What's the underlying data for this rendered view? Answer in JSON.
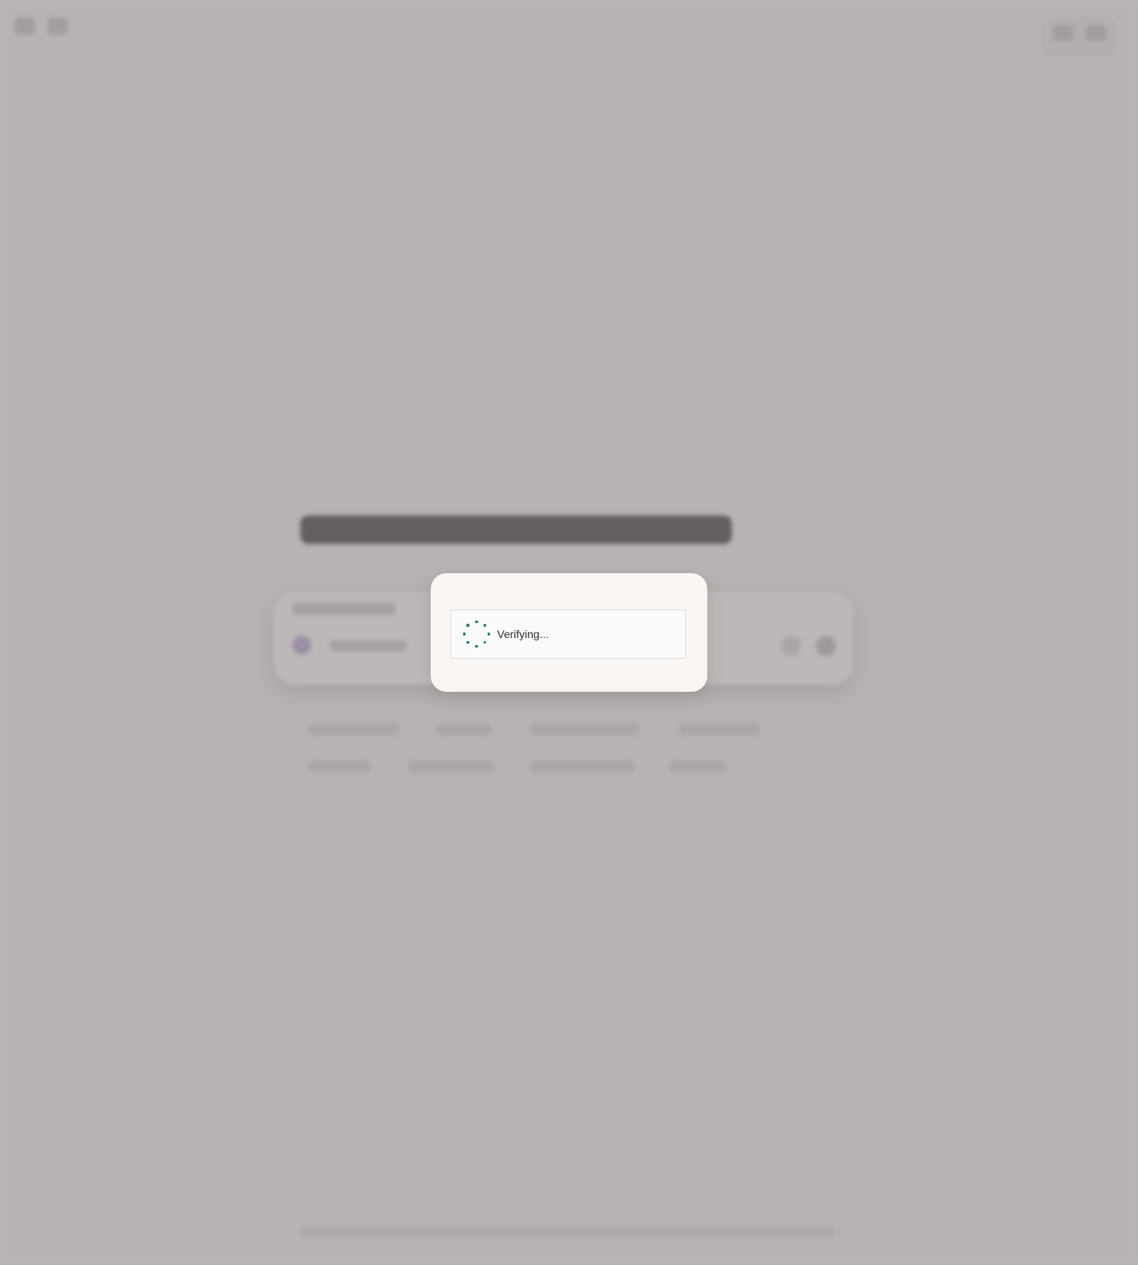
{
  "modal": {
    "status_text": "Verifying..."
  },
  "colors": {
    "overlay_background": "#b8b3b2",
    "modal_background": "#f8f5f2",
    "spinner_color": "#1f7a5c"
  },
  "icons": {
    "spinner": "loading-spinner-icon"
  }
}
